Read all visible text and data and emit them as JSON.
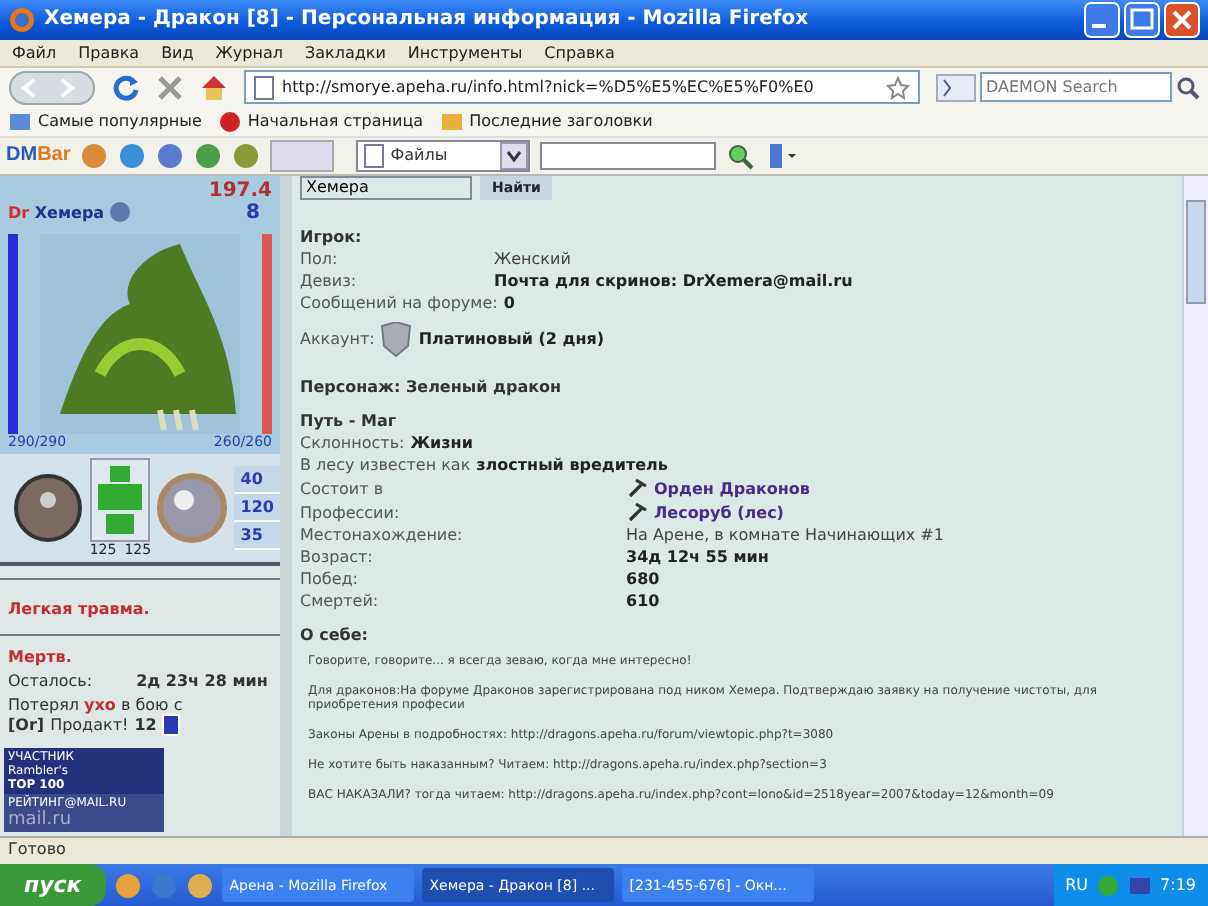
{
  "window": {
    "title": "Хемера - Дракон [8] - Персональная информация - Mozilla Firefox"
  },
  "menu": [
    "Файл",
    "Правка",
    "Вид",
    "Журнал",
    "Закладки",
    "Инструменты",
    "Справка"
  ],
  "address": {
    "url": "http://smorye.apeha.ru/info.html?nick=%D5%E5%EC%E5%F0%E0"
  },
  "search": {
    "placeholder": "DAEMON Search"
  },
  "bookmarks": [
    "Самые популярные",
    "Начальная страница",
    "Последние заголовки"
  ],
  "dmbar": {
    "logo_left": "DM",
    "logo_right": "Bar",
    "dropdown": "Файлы"
  },
  "finder": {
    "value": "Хемера",
    "button": "Найти"
  },
  "character": {
    "score": "197.4",
    "clan": "Dr",
    "name": "Хемера",
    "level": "8",
    "hp": "290/290",
    "mana": "260/260",
    "stats": [
      "40",
      "120",
      "35"
    ],
    "armor": [
      "125",
      "125"
    ]
  },
  "injury": "Легкая травма.",
  "death": {
    "title": "Мертв.",
    "label": "Осталось:",
    "value": "2д 23ч 28 мин",
    "lost": "Потерял **ухо** в бою с",
    "killer_clan": "[Or]",
    "killer": "Продакт!",
    "killer_level": "12"
  },
  "badges": {
    "rambler_top": "УЧАСТНИК",
    "rambler_name": "Rambler's",
    "rambler_rank": "TOP 100",
    "mail_label": "РЕЙТИНГ@MAIL.RU",
    "mail_brand": "mail.ru"
  },
  "info": [
    {
      "kind": "heading",
      "text": "Игрок:"
    },
    {
      "kind": "gender",
      "label": "Пол:",
      "value": "Женский"
    },
    {
      "kind": "motto",
      "label": "Девиз:",
      "value": "Почта для скринов: DrXemera@mail.ru"
    },
    {
      "kind": "count",
      "label": "Сообщений на форуме:",
      "value": "0"
    },
    {
      "kind": "account",
      "label": "Аккаунт:",
      "value": "Платиновый (2 дня)"
    },
    {
      "kind": "heading",
      "text": "Персонаж: Зеленый дракон"
    },
    {
      "kind": "heading",
      "text": "Путь - Маг"
    },
    {
      "kind": "sentence",
      "text": "Склонность: **Жизни**"
    },
    {
      "kind": "sentence",
      "text": "В лесу известен как **злостный вредитель**"
    },
    {
      "kind": "membership",
      "label": "Состоит в",
      "value": "Орден Драконов"
    },
    {
      "kind": "membership",
      "label": "Профессии:",
      "value": "Лесоруб (лес)"
    },
    {
      "kind": "location",
      "label": "Местонахождение:",
      "value": "На Арене, в комнате Начинающих #1"
    },
    {
      "kind": "stat",
      "label": "Возраст:",
      "value": "34д 12ч 55 мин"
    },
    {
      "kind": "stat",
      "label": "Побед:",
      "value": "680"
    },
    {
      "kind": "stat",
      "label": "Смертей:",
      "value": "610"
    },
    {
      "kind": "heading",
      "text": "О себе:"
    }
  ],
  "about": [
    "Говорите, говорите... я всегда зеваю, когда мне интересно!",
    "Для драконов:На форуме Драконов зарегистрирована под ником Хемера. Подтверждаю заявку на получение чистоты, для приобретения професии",
    "Законы Арены в подробностях: http://dragons.apeha.ru/forum/viewtopic.php?t=3080",
    "Не хотите быть наказанным? Читаем: http://dragons.apeha.ru/index.php?section=3",
    "ВАС НАКАЗАЛИ? тогда читаем: http://dragons.apeha.ru/index.php?cont=lono&id=2518year=2007&today=12&month=09"
  ],
  "status_bar": "Готово",
  "taskbar": {
    "start": "пуск",
    "tasks": [
      {
        "label": "Арена - Mozilla Firefox",
        "selected": false
      },
      {
        "label": "Хемера - Дракон [8] ...",
        "selected": true
      },
      {
        "label": "[231-455-676] - Окн...",
        "selected": false
      }
    ],
    "language": "RU",
    "clock": "7:19"
  }
}
